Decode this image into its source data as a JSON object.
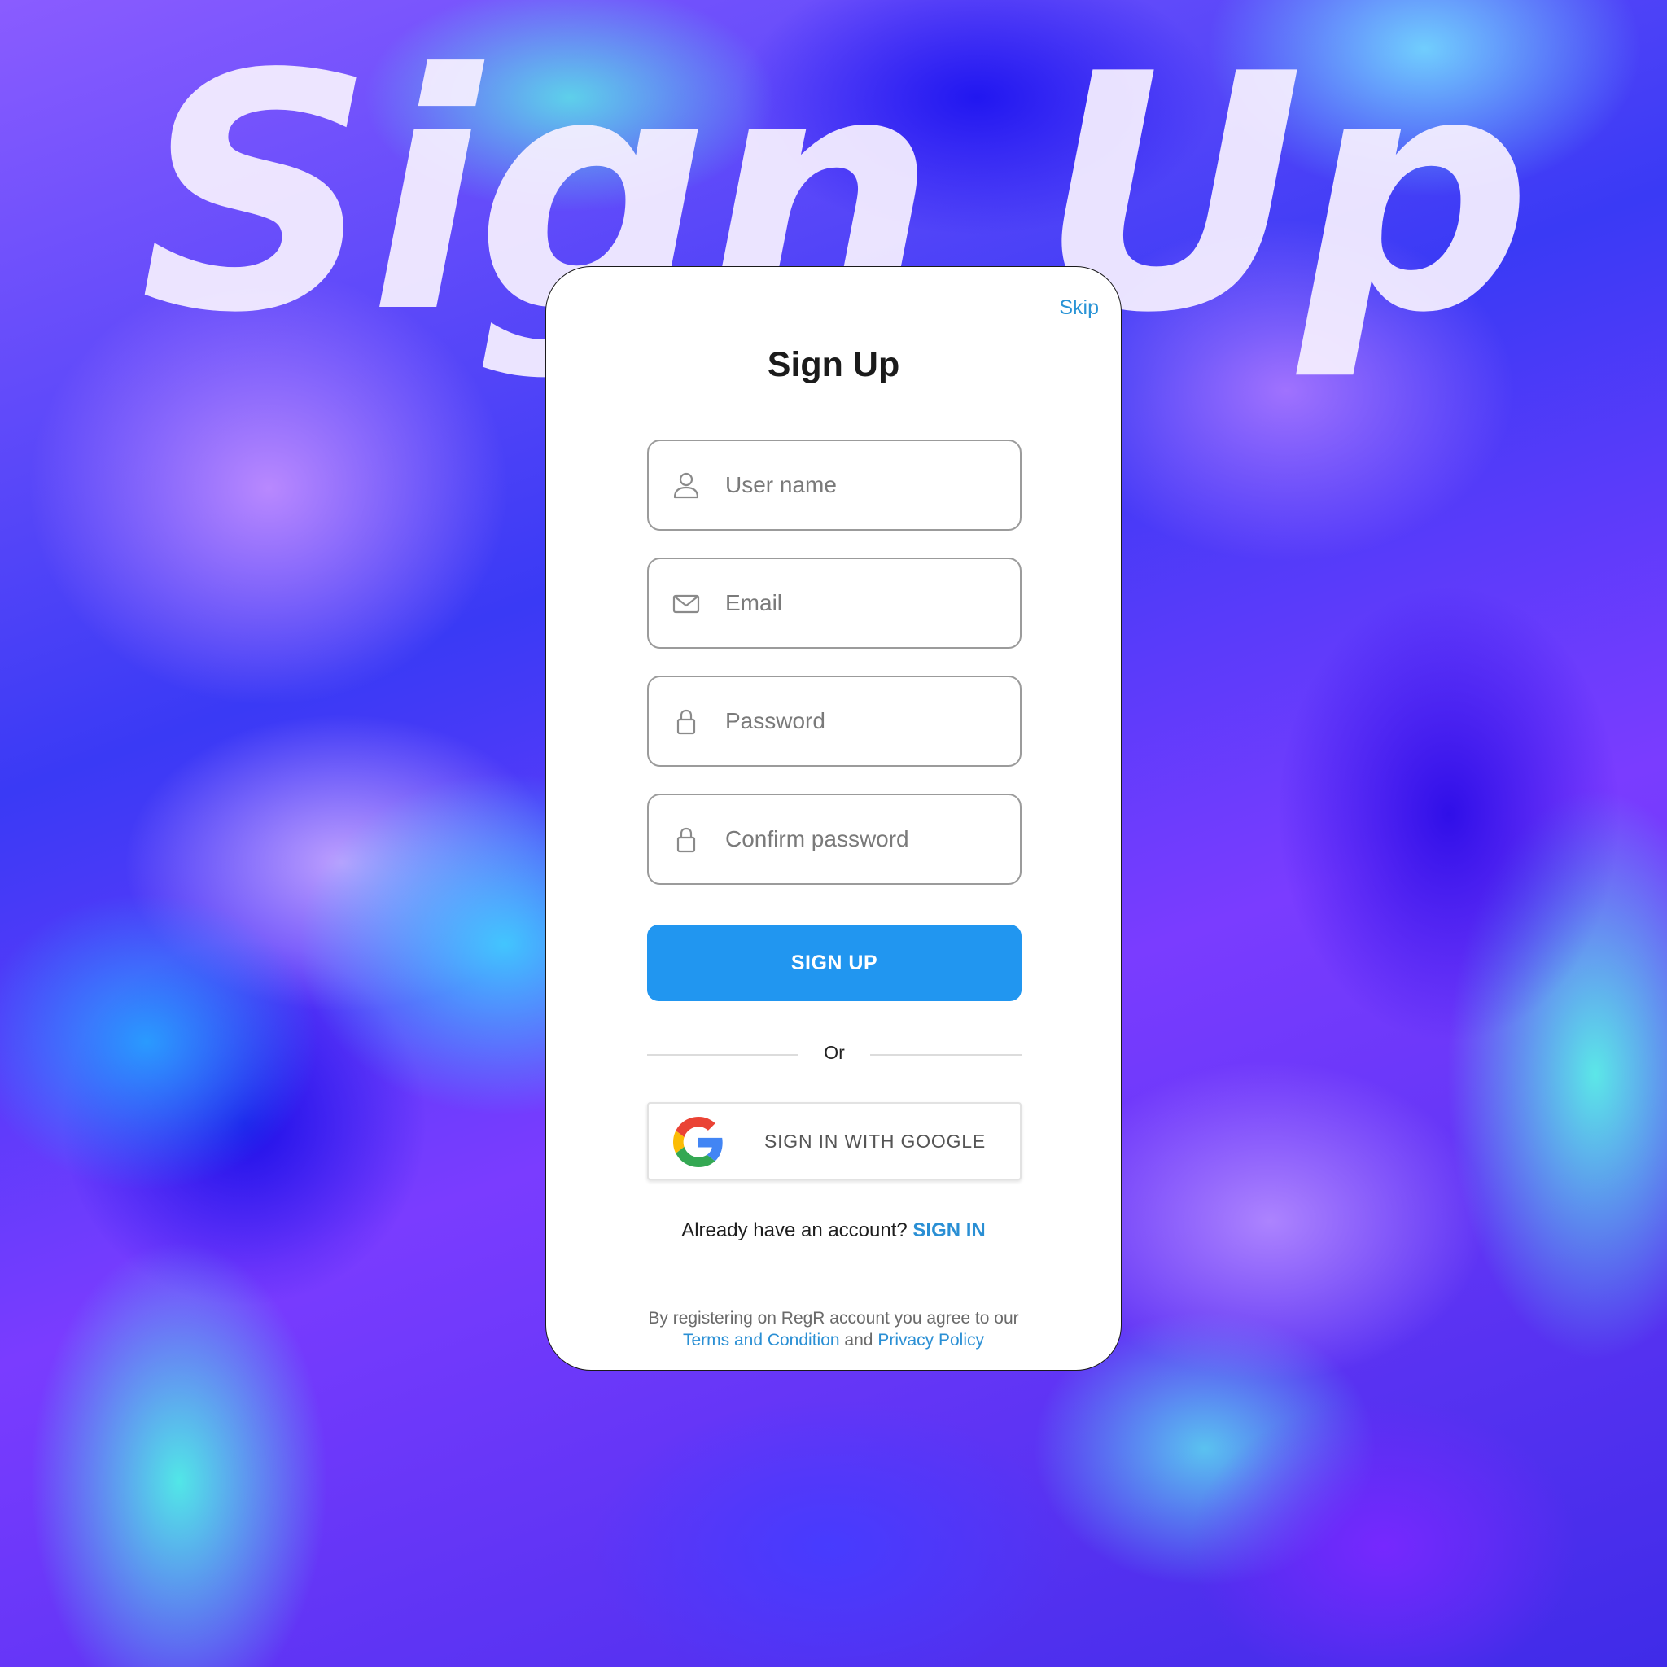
{
  "background": {
    "title": "Sign Up"
  },
  "card": {
    "skip_label": "Skip",
    "title": "Sign Up",
    "fields": [
      {
        "placeholder": "User name",
        "icon": "user-icon"
      },
      {
        "placeholder": "Email",
        "icon": "mail-icon"
      },
      {
        "placeholder": "Password",
        "icon": "lock-icon"
      },
      {
        "placeholder": "Confirm password",
        "icon": "lock-icon"
      }
    ],
    "signup_button": "SIGN UP",
    "divider_text": "Or",
    "google_button": "SIGN IN WITH GOOGLE",
    "account_prompt": "Already have an account?",
    "signin_link": "SIGN IN",
    "terms_prefix": "By registering on RegR account you agree to our",
    "terms_link": "Terms and Condition",
    "terms_and": "and",
    "privacy_link": "Privacy Policy"
  },
  "colors": {
    "primary": "#2196f0",
    "link": "#2a8fd4",
    "title_text": "#1b1b1b",
    "field_border": "#9b9b9b"
  }
}
